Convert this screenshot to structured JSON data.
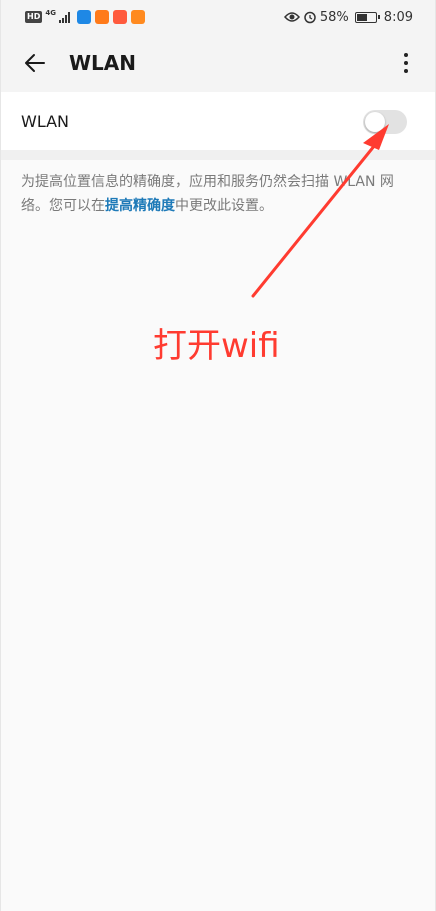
{
  "status_bar": {
    "hd_badge": "HD",
    "network": "4G",
    "battery_percent": "58%",
    "battery_level": 0.58,
    "time": "8:09",
    "app_icons": [
      {
        "name": "security-app-icon",
        "color": "#1e88e5"
      },
      {
        "name": "video-app-icon",
        "color": "#ff7a1a"
      },
      {
        "name": "store-app-icon",
        "color": "#ff5a3d"
      },
      {
        "name": "play-app-icon",
        "color": "#ff8a1f"
      }
    ]
  },
  "header": {
    "title": "WLAN",
    "back_icon": "arrow-left-icon",
    "more_icon": "more-vertical-icon"
  },
  "wlan": {
    "label": "WLAN",
    "enabled": false
  },
  "description": {
    "text_before": "为提高位置信息的精确度，应用和服务仍然会扫描 WLAN 网络。您可以在",
    "link": "提高精确度",
    "text_after": "中更改此设置。"
  },
  "annotation": {
    "text": "打开wifi",
    "color": "#ff3b30"
  },
  "colors": {
    "accent_link": "#1e7ab8",
    "toggle_off": "#e2e2e2"
  }
}
